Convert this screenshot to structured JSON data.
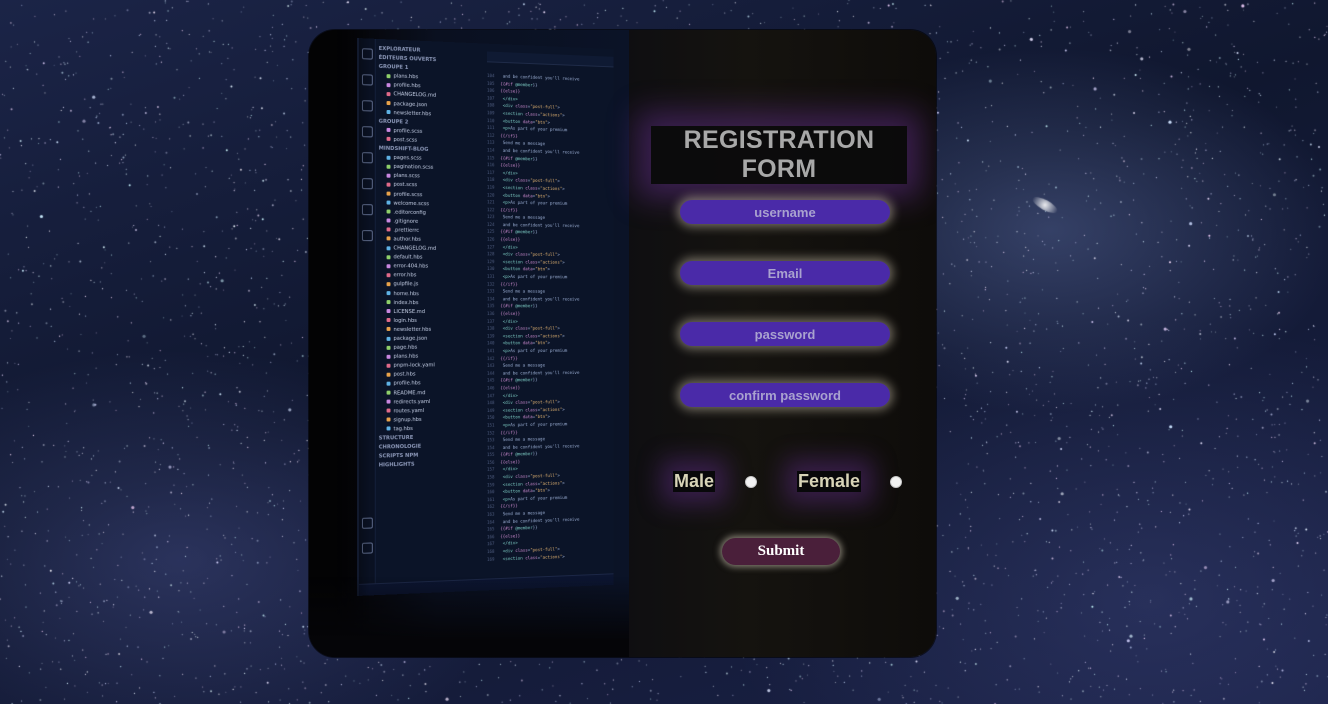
{
  "form": {
    "title": "REGISTRATION FORM",
    "username_placeholder": "username",
    "email_placeholder": "Email",
    "password_placeholder": "password",
    "confirm_password_placeholder": "confirm password",
    "gender_male_label": "Male",
    "gender_female_label": "Female",
    "submit_label": "Submit"
  },
  "editor_image": {
    "sidebar_entries": [
      "EXPLORATEUR",
      "ÉDITEURS OUVERTS",
      "GROUPE 1",
      "plans.hbs",
      "profile.hbs",
      "CHANGELOG.md",
      "package.json",
      "newsletter.hbs",
      "GROUPE 2",
      "profile.scss",
      "post.scss",
      "MINDSHIFT-BLOG",
      "pages.scss",
      "pagination.scss",
      "plans.scss",
      "post.scss",
      "profile.scss",
      "welcome.scss",
      ".editorconfig",
      ".gitignore",
      ".prettierrc",
      "author.hbs",
      "CHANGELOG.md",
      "default.hbs",
      "error-404.hbs",
      "error.hbs",
      "gulpfile.js",
      "home.hbs",
      "index.hbs",
      "LICENSE.md",
      "login.hbs",
      "newsletter.hbs",
      "package.json",
      "page.hbs",
      "plans.hbs",
      "pnpm-lock.yaml",
      "post.hbs",
      "profile.hbs",
      "README.md",
      "redirects.yaml",
      "routes.yaml",
      "signup.hbs",
      "tag.hbs",
      "STRUCTURE",
      "CHRONOLOGIE",
      "SCRIPTS NPM",
      "HIGHLIGHTS"
    ]
  },
  "colors": {
    "field_bg": "#4a2aa8",
    "submit_bg": "#4a1f3a",
    "glow": "#6e32a0"
  }
}
